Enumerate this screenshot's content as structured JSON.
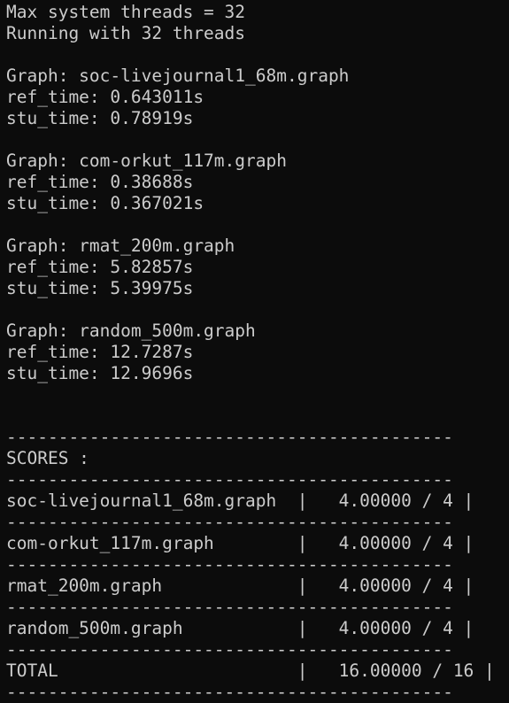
{
  "terminal": {
    "lines": [
      "Max system threads = 32",
      "Running with 32 threads",
      "",
      "Graph: soc-livejournal1_68m.graph",
      "ref_time: 0.643011s",
      "stu_time: 0.78919s",
      "",
      "Graph: com-orkut_117m.graph",
      "ref_time: 0.38688s",
      "stu_time: 0.367021s",
      "",
      "Graph: rmat_200m.graph",
      "ref_time: 5.82857s",
      "stu_time: 5.39975s",
      "",
      "Graph: random_500m.graph",
      "ref_time: 12.7287s",
      "stu_time: 12.9696s",
      "",
      "",
      "-------------------------------------------",
      "SCORES :",
      "-------------------------------------------",
      "soc-livejournal1_68m.graph  |   4.00000 / 4 |",
      "-------------------------------------------",
      "com-orkut_117m.graph        |   4.00000 / 4 |",
      "-------------------------------------------",
      "rmat_200m.graph             |   4.00000 / 4 |",
      "-------------------------------------------",
      "random_500m.graph           |   4.00000 / 4 |",
      "-------------------------------------------",
      "TOTAL                       |   16.00000 / 16 |",
      "-------------------------------------------"
    ]
  }
}
